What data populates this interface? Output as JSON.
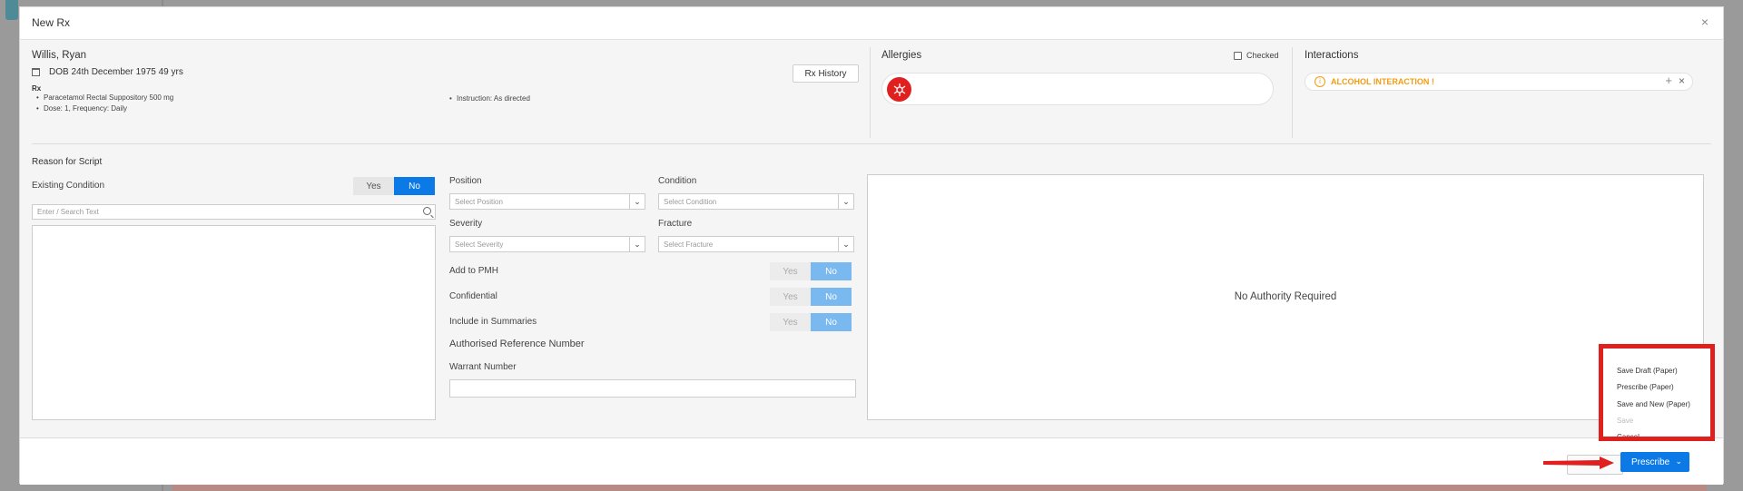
{
  "modal": {
    "title": "New Rx",
    "close": "×"
  },
  "patient": {
    "name": "Willis, Ryan",
    "dob": "DOB 24th December 1975 49 yrs",
    "rx_label": "Rx",
    "rx_items": [
      "Paracetamol Rectal Suppository 500 mg",
      "Dose: 1, Frequency: Daily"
    ],
    "instruction": "Instruction: As directed",
    "rx_history_button": "Rx History"
  },
  "allergies": {
    "title": "Allergies",
    "checked_label": "Checked"
  },
  "interactions": {
    "title": "Interactions",
    "item": "ALCOHOL INTERACTION !",
    "plus": "+",
    "remove": "×"
  },
  "reason": {
    "title": "Reason for Script",
    "existing_condition_label": "Existing Condition",
    "yes": "Yes",
    "no": "No",
    "search_placeholder": "Enter / Search Text"
  },
  "fields": {
    "position_label": "Position",
    "position_placeholder": "Select Position",
    "condition_label": "Condition",
    "condition_placeholder": "Select Condition",
    "severity_label": "Severity",
    "severity_placeholder": "Select Severity",
    "fracture_label": "Fracture",
    "fracture_placeholder": "Select Fracture",
    "add_pmh_label": "Add to PMH",
    "confidential_label": "Confidential",
    "include_summaries_label": "Include in Summaries",
    "authorised_ref_label": "Authorised Reference Number",
    "warrant_label": "Warrant Number"
  },
  "authority": {
    "text": "No Authority Required"
  },
  "dropdown": {
    "items": [
      "Save Draft (Paper)",
      "Prescribe (Paper)",
      "Save and New (Paper)",
      "Save",
      "Cancel"
    ]
  },
  "footer": {
    "prescribe_label": "Prescribe"
  },
  "colors": {
    "primary": "#0b79e6",
    "highlight": "#e0201f",
    "warning": "#f39c12"
  }
}
